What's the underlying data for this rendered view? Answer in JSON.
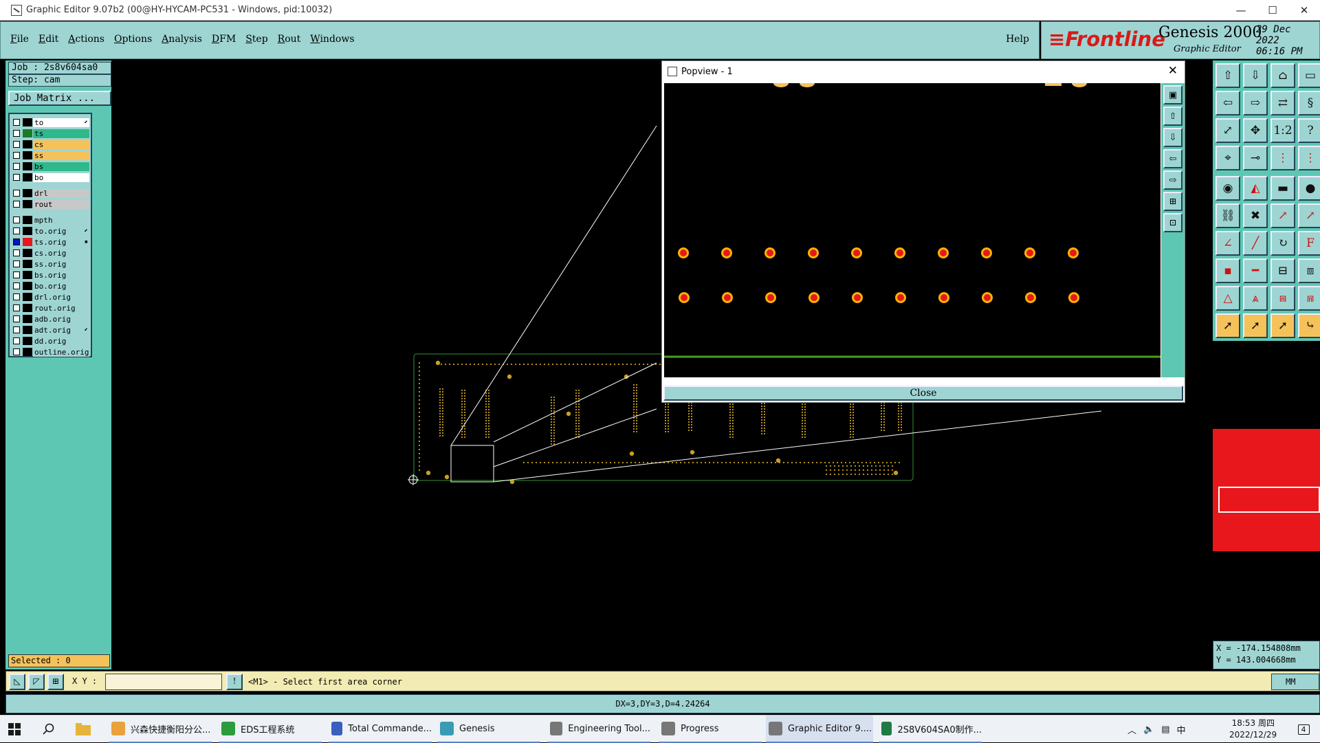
{
  "window": {
    "title": "Graphic Editor 9.07b2 (00@HY-HYCAM-PC531 - Windows, pid:10032)",
    "minimize": "—",
    "maximize": "☐",
    "close": "✕"
  },
  "menu": [
    "File",
    "Edit",
    "Actions",
    "Options",
    "Analysis",
    "DFM",
    "Step",
    "Rout",
    "Windows"
  ],
  "help": "Help",
  "brand": {
    "logo": "Frontline",
    "product": "Genesis 2000",
    "subtitle": "Graphic Editor",
    "date": "29 Dec 2022",
    "time": "06:16 PM"
  },
  "job": {
    "job_line": "Job : 2s8v604sa0",
    "step_line": "Step: cam",
    "matrix_button": "Job Matrix ..."
  },
  "layers": [
    {
      "name": "to",
      "swatch": "#000000",
      "bg": "#ffffff",
      "mark": "⬋",
      "checked": false
    },
    {
      "name": "ts",
      "swatch": "#1b7a2a",
      "bg": "#2fb88a",
      "mark": "",
      "checked": false
    },
    {
      "name": "cs",
      "swatch": "#000000",
      "bg": "#f5c25a",
      "mark": "",
      "checked": false
    },
    {
      "name": "ss",
      "swatch": "#000000",
      "bg": "#f5c25a",
      "mark": "",
      "checked": false
    },
    {
      "name": "bs",
      "swatch": "#000000",
      "bg": "#2fb88a",
      "mark": "",
      "checked": false
    },
    {
      "name": "bo",
      "swatch": "#000000",
      "bg": "#ffffff",
      "mark": "",
      "checked": false
    },
    {
      "gap": true
    },
    {
      "name": "drl",
      "swatch": "#000000",
      "bg": "#c8c8c8",
      "mark": "",
      "checked": false
    },
    {
      "name": "rout",
      "swatch": "#000000",
      "bg": "#c8c8c8",
      "mark": "",
      "checked": false
    },
    {
      "gap": true
    },
    {
      "name": "mpth",
      "swatch": "#000000",
      "bg": "#9ed5d3",
      "mark": "",
      "checked": false
    },
    {
      "name": "to.orig",
      "swatch": "#000000",
      "bg": "#9ed5d3",
      "mark": "⬋",
      "checked": false
    },
    {
      "name": "ts.orig",
      "swatch": "#e8171b",
      "bg": "#9ed5d3",
      "mark": "▪",
      "checked": true
    },
    {
      "name": "cs.orig",
      "swatch": "#000000",
      "bg": "#9ed5d3",
      "mark": "",
      "checked": false
    },
    {
      "name": "ss.orig",
      "swatch": "#000000",
      "bg": "#9ed5d3",
      "mark": "",
      "checked": false
    },
    {
      "name": "bs.orig",
      "swatch": "#000000",
      "bg": "#9ed5d3",
      "mark": "",
      "checked": false
    },
    {
      "name": "bo.orig",
      "swatch": "#000000",
      "bg": "#9ed5d3",
      "mark": "",
      "checked": false
    },
    {
      "name": "drl.orig",
      "swatch": "#000000",
      "bg": "#9ed5d3",
      "mark": "",
      "checked": false
    },
    {
      "name": "rout.orig",
      "swatch": "#000000",
      "bg": "#9ed5d3",
      "mark": "",
      "checked": false
    },
    {
      "name": "adb.orig",
      "swatch": "#000000",
      "bg": "#9ed5d3",
      "mark": "",
      "checked": false
    },
    {
      "name": "adt.orig",
      "swatch": "#000000",
      "bg": "#9ed5d3",
      "mark": "⬋",
      "checked": false
    },
    {
      "name": "dd.orig",
      "swatch": "#000000",
      "bg": "#9ed5d3",
      "mark": "",
      "checked": false
    },
    {
      "name": "outline.orig",
      "swatch": "#000000",
      "bg": "#9ed5d3",
      "mark": "",
      "checked": false
    }
  ],
  "selected": "Selected : 0",
  "popview": {
    "title": "Popview - 1",
    "close_x": "✕",
    "close_button": "Close"
  },
  "coords": {
    "x": "X = -174.154808mm",
    "y": "Y = 143.004668mm"
  },
  "cmd": {
    "xy_label": "X Y :",
    "xy_value": "",
    "message": "<M1> - Select first area corner",
    "unit": "MM"
  },
  "status": "DX=3,DY=3,D=4.24264",
  "taskbar": {
    "items": [
      {
        "label": "兴森快捷衡阳分公...",
        "color": "#e9a23b"
      },
      {
        "label": "EDS工程系统",
        "color": "#2d9c3c"
      },
      {
        "label": "Total Commande...",
        "color": "#3b5fbf"
      },
      {
        "label": "Genesis",
        "color": "#3a9bb5"
      },
      {
        "label": "Engineering Tool...",
        "color": "#777777"
      },
      {
        "label": "Progress",
        "color": "#777777"
      },
      {
        "label": "Graphic Editor 9....",
        "color": "#777777"
      },
      {
        "label": "2S8V604SA0制作...",
        "color": "#1f7a43"
      }
    ],
    "time": "18:53 周四",
    "date": "2022/12/29",
    "ime": "中",
    "notif": "4"
  },
  "colors": {
    "panel": "#5ec7b3",
    "button": "#9ed5d3",
    "pad": "#e8171b",
    "pad_ring": "#f5b400",
    "board": "#c8a020"
  }
}
